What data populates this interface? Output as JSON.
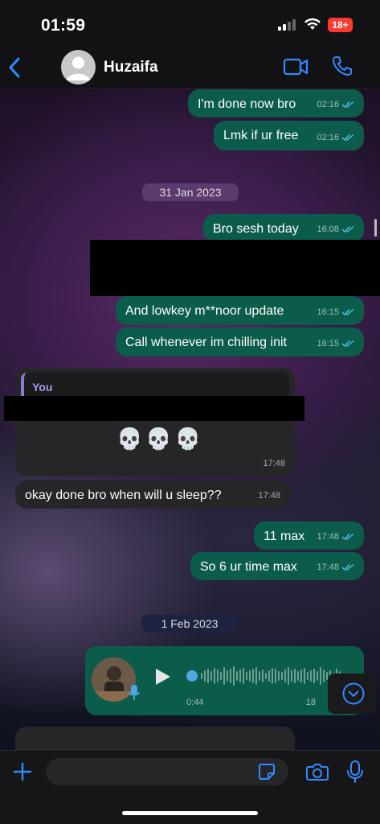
{
  "status_bar": {
    "time": "01:59",
    "battery": "18+"
  },
  "header": {
    "contact_name": "Huzaifa"
  },
  "messages": [
    {
      "text": "I'm done now bro",
      "time": "02:16"
    },
    {
      "text": "Lmk if ur free",
      "time": "02:16"
    },
    {
      "text": "Bro sesh today",
      "time": "16:08"
    },
    {
      "text": "And lowkey m**noor update",
      "time": "16:15"
    },
    {
      "text": "Call whenever im chilling init",
      "time": "16:15"
    },
    {
      "reply_to": "You",
      "text": "💀💀💀",
      "time": "17:48"
    },
    {
      "text": "okay done bro when will u sleep??",
      "time": "17:48"
    },
    {
      "text": "11 max",
      "time": "17:48"
    },
    {
      "text": "So 6 ur time max",
      "time": "17:48"
    }
  ],
  "dates": [
    "31 Jan 2023",
    "1 Feb 2023"
  ],
  "voice_note": {
    "duration": "0:44",
    "time": "18"
  },
  "colors": {
    "outgoing": "#0b5c4a",
    "incoming": "#262628",
    "accent": "#2f8cff",
    "read_ticks": "#53bdeb"
  }
}
